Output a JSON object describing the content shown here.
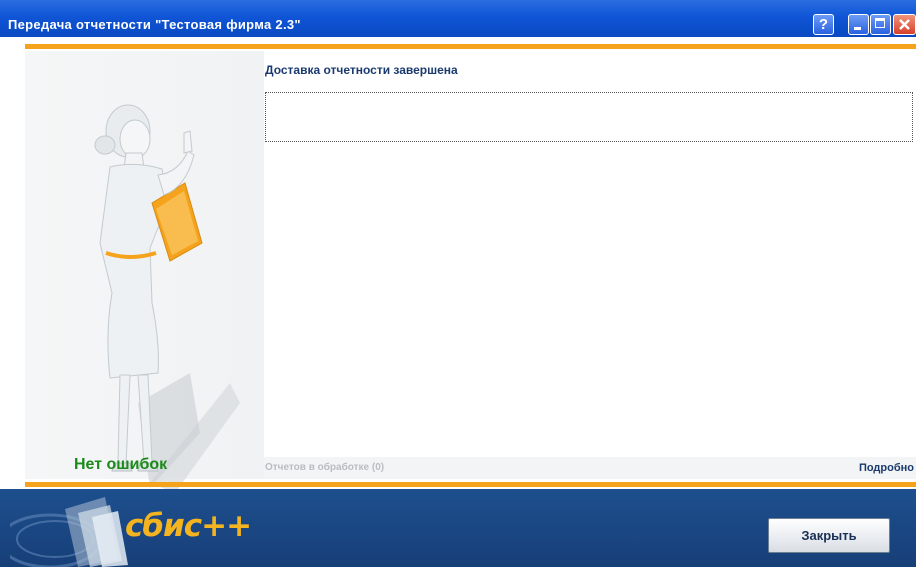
{
  "window": {
    "title": "Передача отчетности \"Тестовая фирма 2.3\"",
    "help_label": "?"
  },
  "left_panel": {
    "status": "Нет ошибок",
    "status_color": "#1c8a1a",
    "illustration": "woman-thumbs-up-illustration"
  },
  "main": {
    "heading": "Доставка отчетности завершена",
    "message": ""
  },
  "footer": {
    "pending": "Отчетов в обработке (0)",
    "details_link": "Подробно"
  },
  "bottom": {
    "logo_text": "сбис++",
    "close_label": "Закрыть"
  },
  "colors": {
    "titlebar": "#0f55d6",
    "accent_orange": "#f5a31c",
    "bottom_band": "#1d4f8e",
    "logo": "#f4b41f"
  }
}
